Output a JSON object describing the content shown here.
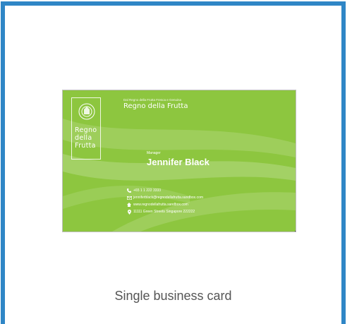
{
  "caption": "Single business card",
  "colors": {
    "border": "#2f86c6",
    "card_green": "#8dc63f",
    "card_text": "#ffffff",
    "caption_text": "#555555"
  },
  "card": {
    "logo": {
      "line1": "Regno",
      "line2": "della",
      "line3": "Frutta"
    },
    "tagline": "Dal Regno della Frutta Fresca e Genuina",
    "brand": "Regno della Frutta",
    "role": "Manager",
    "person_name": "Jennifer Black",
    "contacts": [
      {
        "icon": "phone-icon",
        "text": "+65 1 1 222 3333"
      },
      {
        "icon": "email-icon",
        "text": "jenniferblack@regnodellafrutta.sandbox.com"
      },
      {
        "icon": "home-icon",
        "text": "www.regnodellafrutta.sandbox.com"
      },
      {
        "icon": "location-pin-icon",
        "text": "11111 Green Streets Singapore 222222"
      }
    ]
  }
}
